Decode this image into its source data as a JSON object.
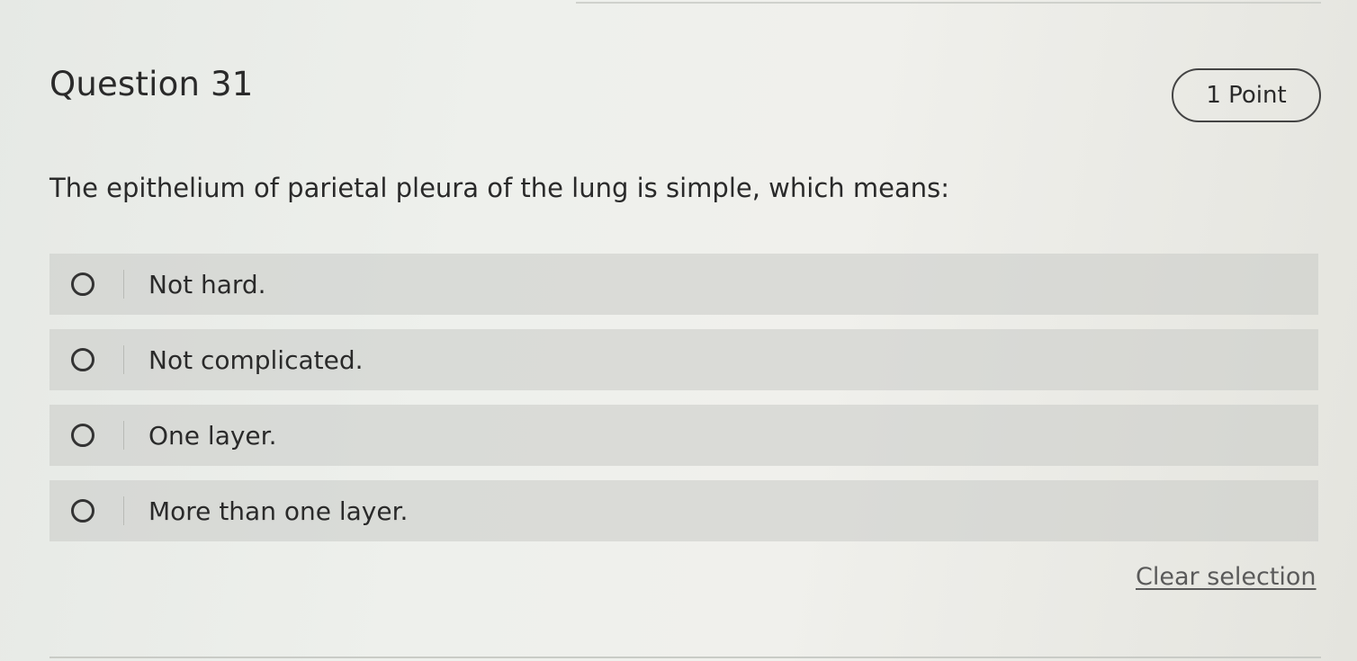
{
  "question": {
    "title": "Question 31",
    "points": "1 Point",
    "text": "The epithelium of parietal pleura of the lung is simple, which means:"
  },
  "options": [
    {
      "label": "Not hard."
    },
    {
      "label": "Not complicated."
    },
    {
      "label": "One layer."
    },
    {
      "label": "More than one layer."
    }
  ],
  "actions": {
    "clear_selection": "Clear selection"
  }
}
